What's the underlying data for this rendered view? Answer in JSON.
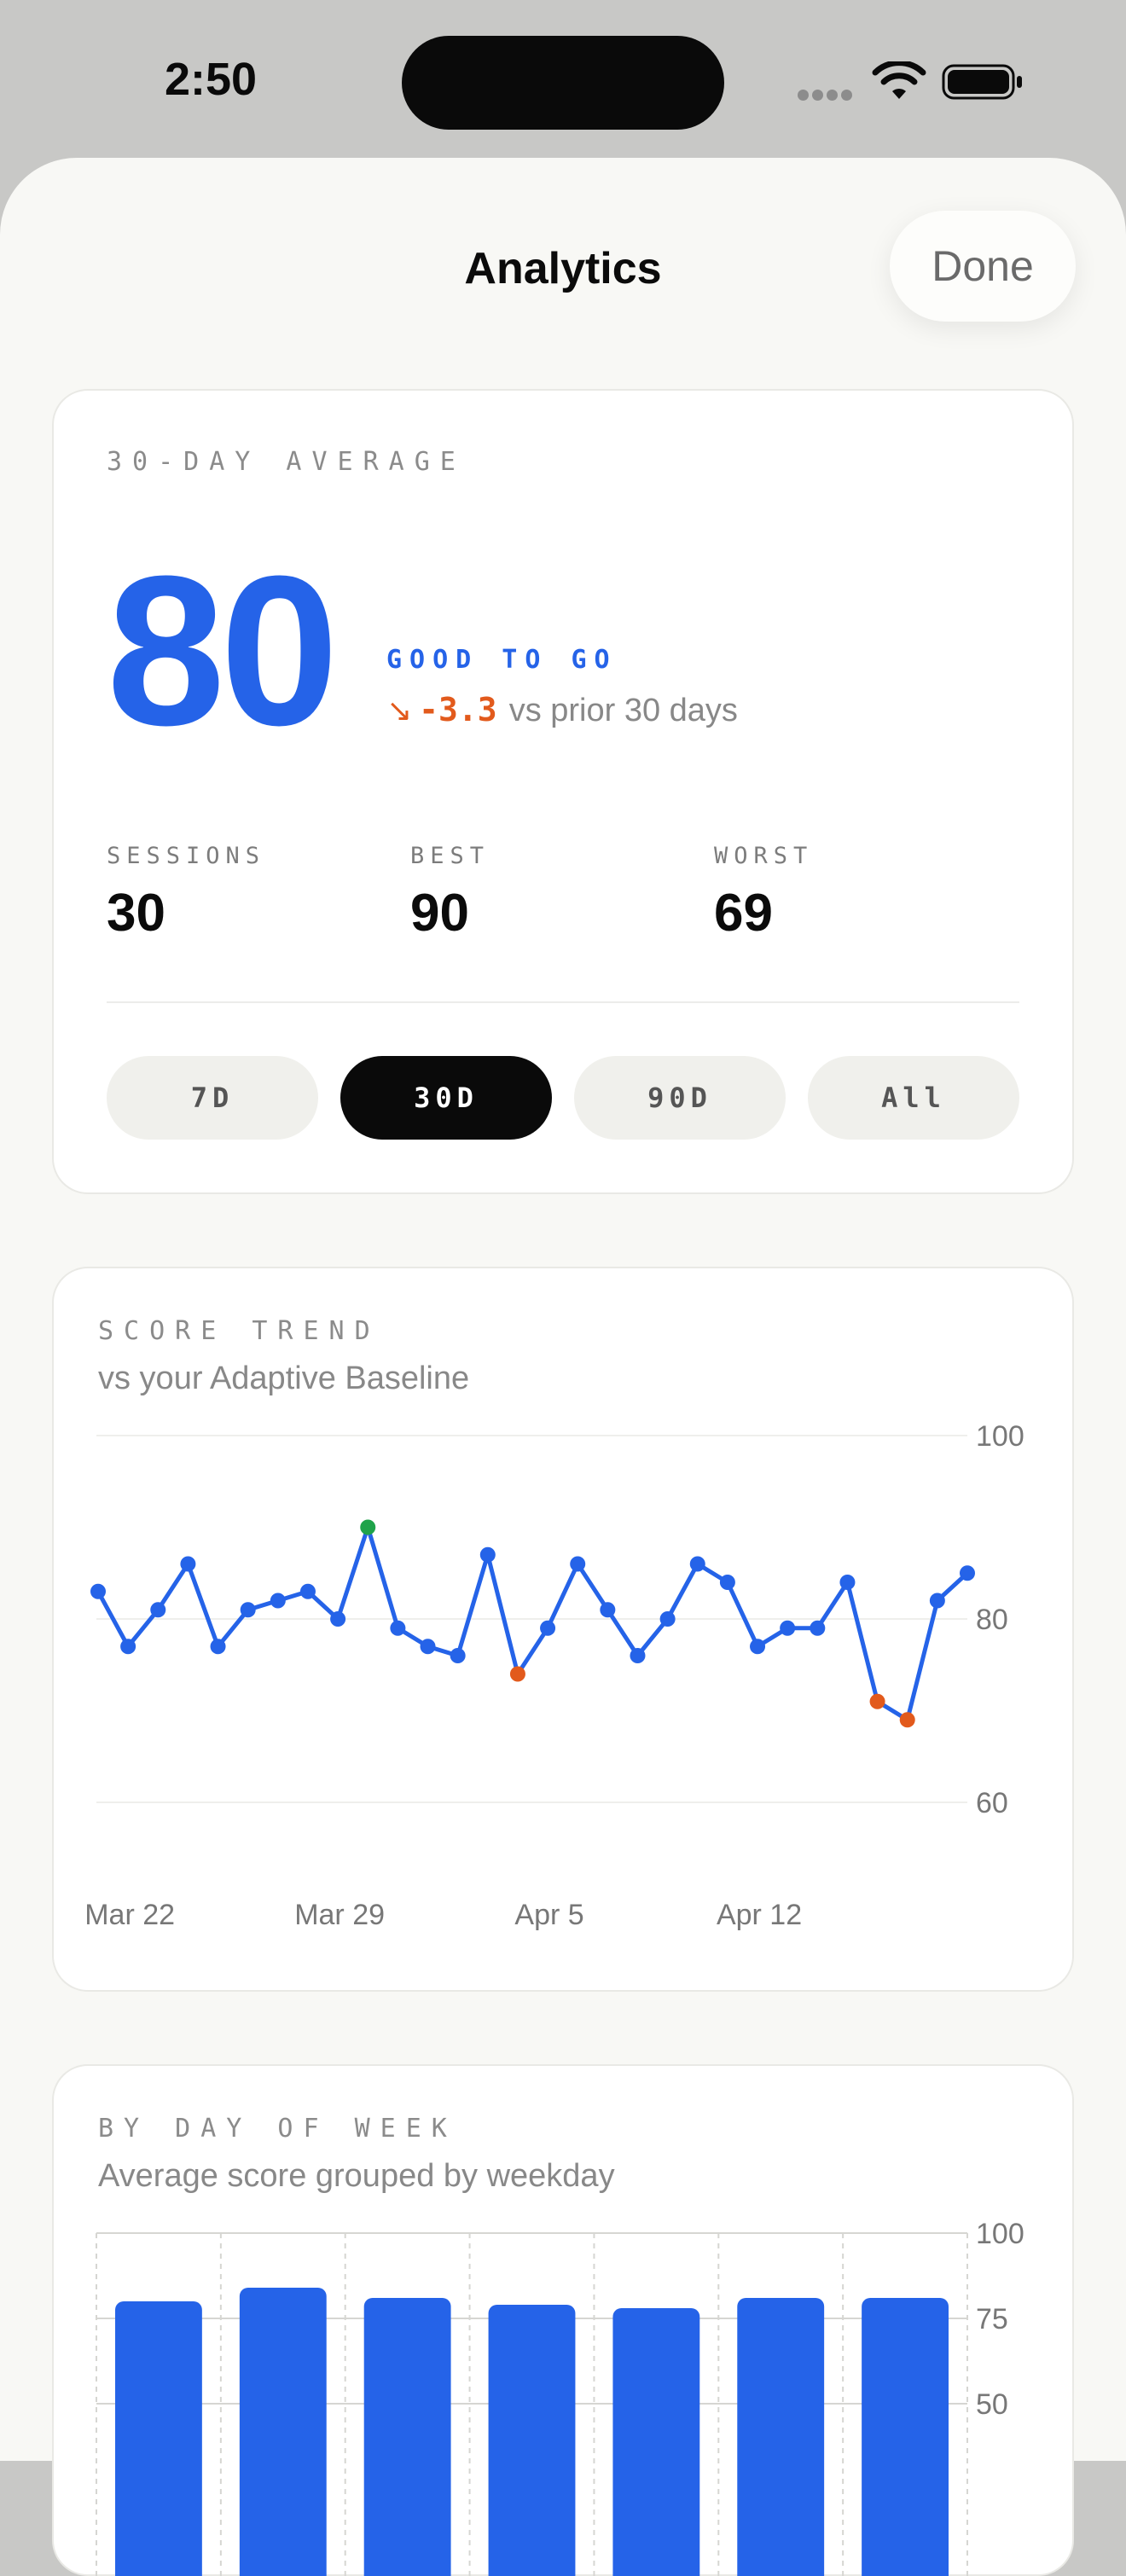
{
  "status_bar": {
    "time": "2:50"
  },
  "header": {
    "title": "Analytics",
    "done_label": "Done"
  },
  "average_card": {
    "eyebrow": "30-DAY AVERAGE",
    "score": "80",
    "status": "GOOD TO GO",
    "delta": "-3.3",
    "delta_suffix": "vs prior 30 days",
    "stats": [
      {
        "label": "SESSIONS",
        "value": "30"
      },
      {
        "label": "BEST",
        "value": "90"
      },
      {
        "label": "WORST",
        "value": "69"
      }
    ],
    "ranges": [
      "7D",
      "30D",
      "90D",
      "All"
    ],
    "selected_range": "30D"
  },
  "trend_card": {
    "eyebrow": "SCORE TREND",
    "subtitle": "vs your Adaptive Baseline"
  },
  "weekday_card": {
    "eyebrow": "BY DAY OF WEEK",
    "subtitle": "Average score grouped by weekday"
  },
  "colors": {
    "accent": "#2563e8",
    "best_point": "#1fa34a",
    "low_point": "#e25a1c",
    "active_segment": "#0a0a0a"
  },
  "chart_data": [
    {
      "type": "line",
      "title": "SCORE TREND",
      "subtitle": "vs your Adaptive Baseline",
      "ylim": [
        60,
        100
      ],
      "y_ticks": [
        100,
        80,
        60
      ],
      "x_tick_labels": [
        "Mar 22",
        "Mar 29",
        "Apr 5",
        "Apr 12"
      ],
      "grid": true,
      "series": [
        {
          "values": [
            83,
            77,
            81,
            86,
            77,
            81,
            82,
            83,
            80,
            90,
            79,
            77,
            76,
            87,
            74,
            79,
            86,
            81,
            76,
            80,
            86,
            84,
            77,
            79,
            79,
            84,
            71,
            69,
            82,
            85
          ],
          "highlight_best_index": 9,
          "highlight_low_indices": [
            14,
            26,
            27
          ]
        }
      ]
    },
    {
      "type": "bar",
      "title": "BY DAY OF WEEK",
      "subtitle": "Average score grouped by weekday",
      "ylim": [
        0,
        100
      ],
      "y_ticks": [
        100,
        75,
        50
      ],
      "values": [
        80,
        84,
        81,
        79,
        78,
        81,
        81
      ],
      "grid": true
    }
  ]
}
